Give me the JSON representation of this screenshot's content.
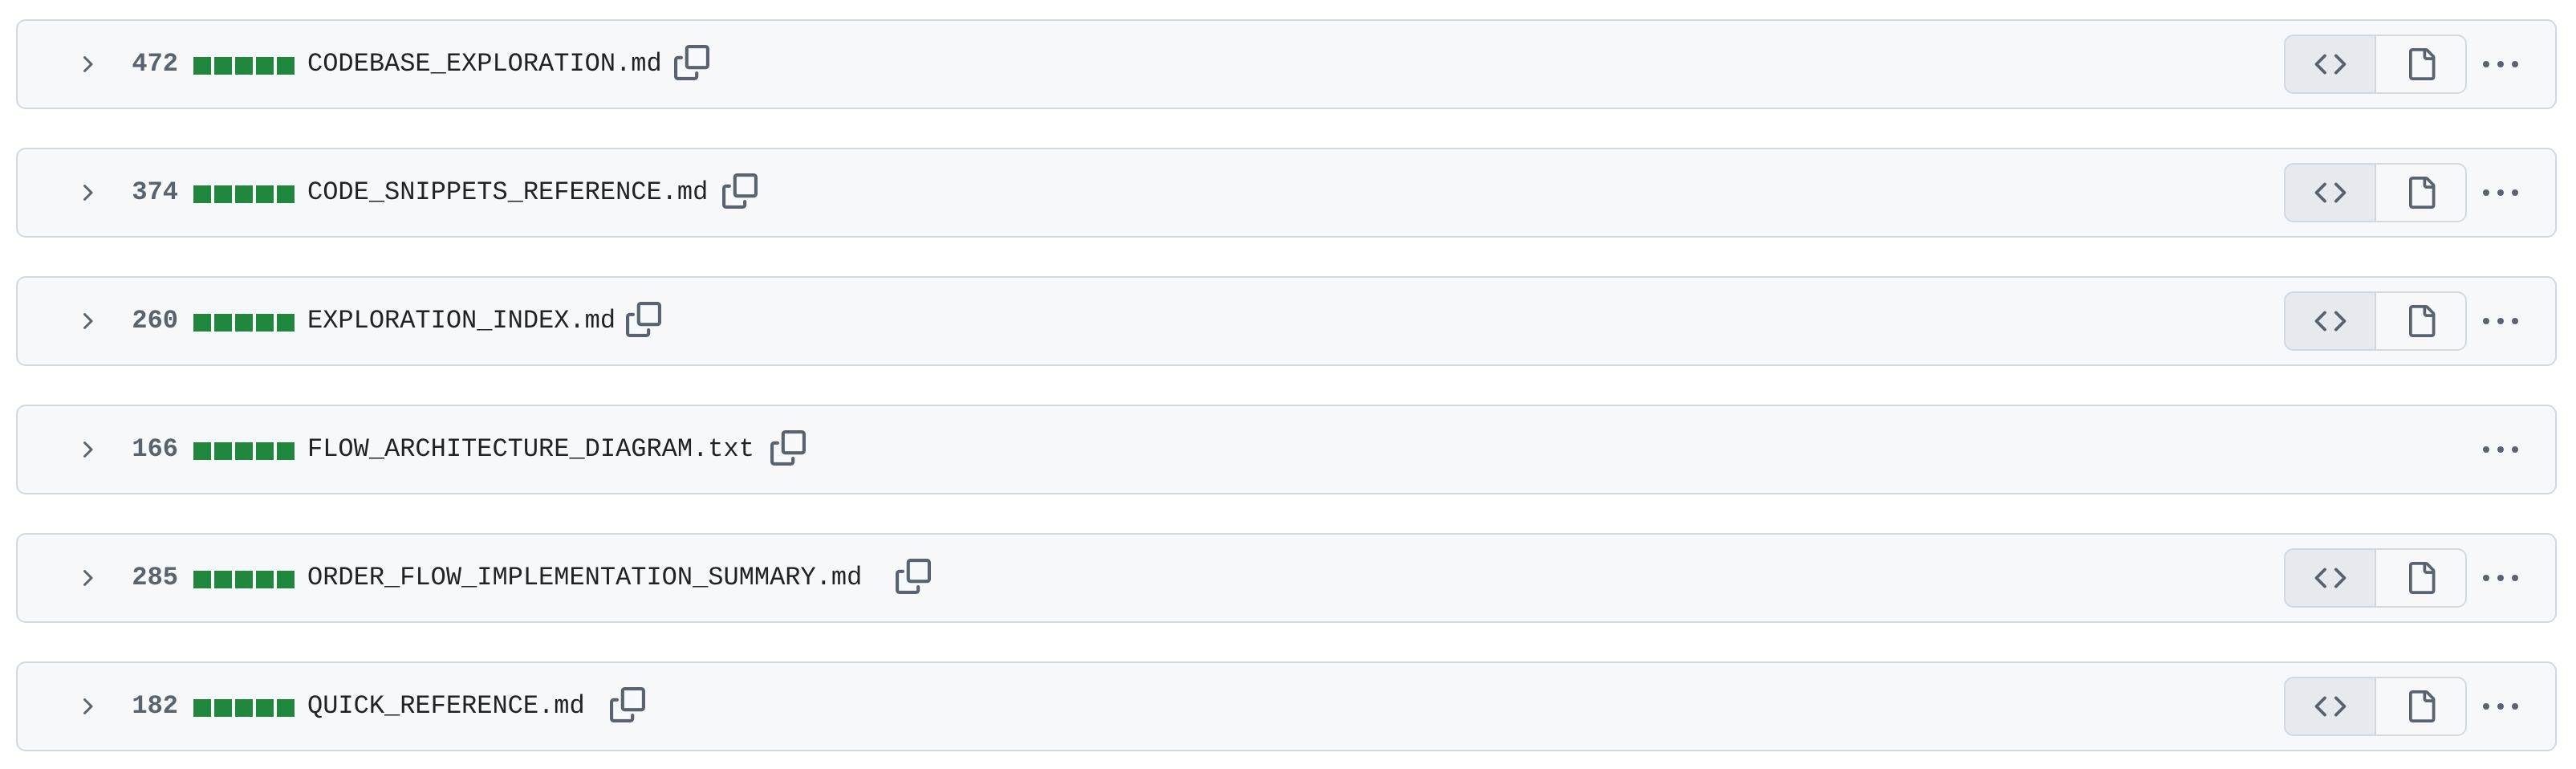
{
  "files": [
    {
      "count": "472",
      "filename": "CODEBASE_EXPLORATION.md",
      "has_view_toggle": true
    },
    {
      "count": "374",
      "filename": "CODE_SNIPPETS_REFERENCE.md",
      "has_view_toggle": true
    },
    {
      "count": "260",
      "filename": "EXPLORATION_INDEX.md",
      "has_view_toggle": true
    },
    {
      "count": "166",
      "filename": "FLOW_ARCHITECTURE_DIAGRAM.txt",
      "has_view_toggle": false
    },
    {
      "count": "285",
      "filename": "ORDER_FLOW_IMPLEMENTATION_SUMMARY.md",
      "has_view_toggle": true
    },
    {
      "count": "182",
      "filename": "QUICK_REFERENCE.md",
      "has_view_toggle": true
    }
  ],
  "diffstat_blocks": 5,
  "icons": {
    "expand": "chevron-right-icon",
    "copy": "copy-icon",
    "code_view": "code-icon",
    "file_view": "file-icon",
    "more": "kebab-horizontal-icon"
  },
  "colors": {
    "additions": "#1f883d",
    "header_bg": "#f6f8fa",
    "border": "#d1d9e0",
    "count_text": "#59636e",
    "filename_text": "#1f2328",
    "icon": "#59636e",
    "active_segment_bg": "#e6eaef"
  }
}
